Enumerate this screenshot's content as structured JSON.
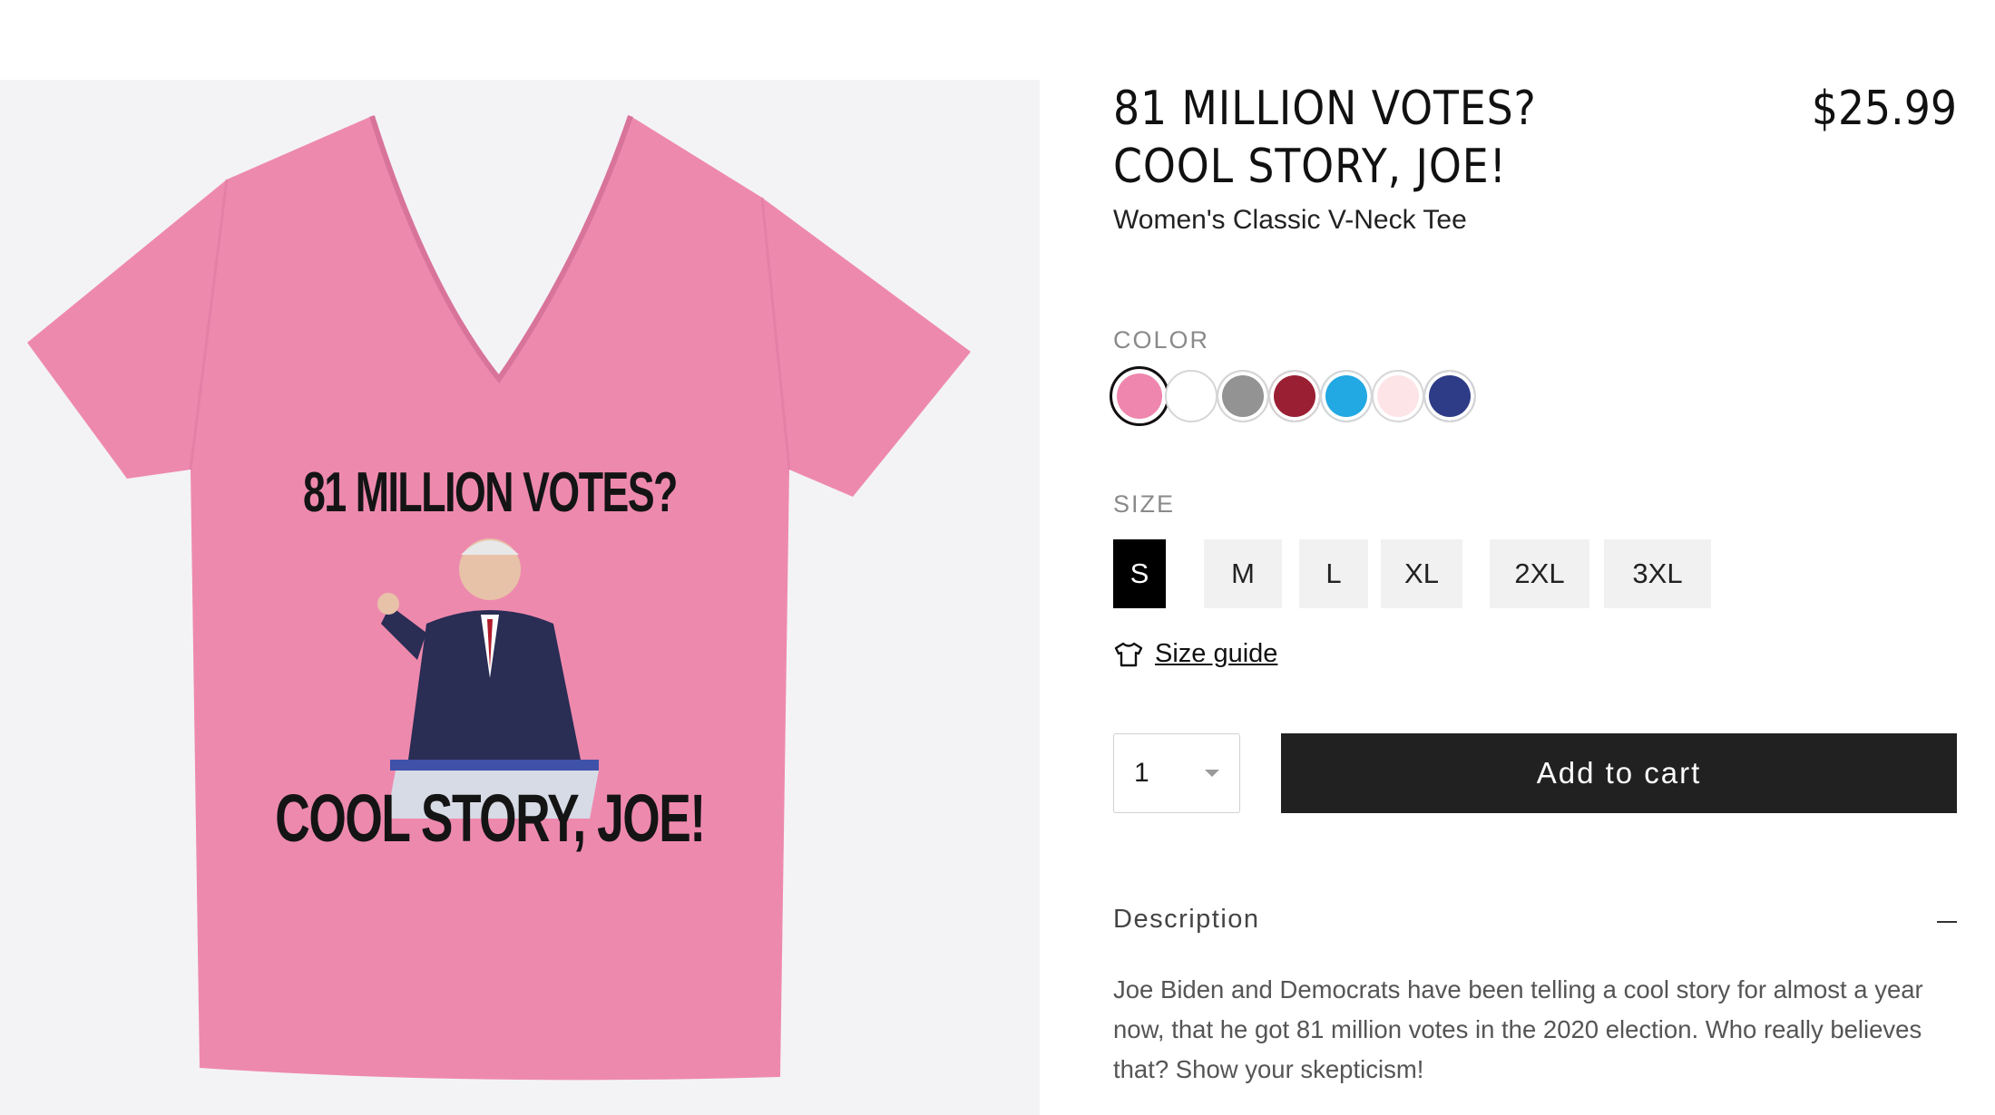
{
  "product": {
    "title": "81 MILLION VOTES? COOL STORY, JOE!",
    "price": "$25.99",
    "subtitle": "Women's Classic V-Neck Tee",
    "print_line_1": "81 MILLION VOTES?",
    "print_line_2": "COOL STORY, JOE!"
  },
  "color": {
    "label": "COLOR",
    "swatches": [
      "#ef86ad",
      "#ffffff",
      "#939393",
      "#9a1f33",
      "#22a8e2",
      "#fde4e7",
      "#2e3b86"
    ],
    "selected_index": 0
  },
  "size": {
    "label": "SIZE",
    "options": [
      "S",
      "M",
      "L",
      "XL",
      "2XL",
      "3XL"
    ],
    "selected": "S",
    "guide_label": "Size guide"
  },
  "purchase": {
    "quantity": "1",
    "add_to_cart_label": "Add to cart"
  },
  "description": {
    "title": "Description",
    "body": "Joe Biden and Democrats have been telling a cool story for almost a year now, that he got 81 million votes in the 2020 election. Who really believes that? Show your skepticism!"
  }
}
